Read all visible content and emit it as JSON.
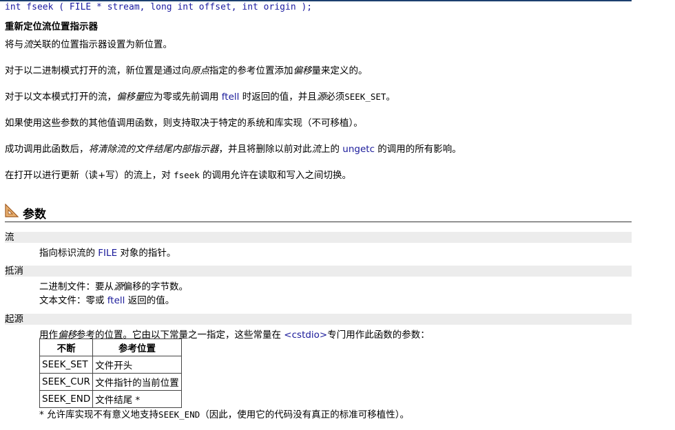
{
  "prototype": "int fseek ( FILE * stream, long int offset, int origin );",
  "heading": "重新定位流位置指示器",
  "p1": {
    "a": "将与",
    "b": "流",
    "c": "关联的位置指示器设置为新位置。"
  },
  "p2": {
    "a": "对于以二进制模式打开的流，新位置是通过向",
    "b": "原点",
    "c": "指定的参考位置添加",
    "d": "偏移",
    "e": "量来定义的。"
  },
  "p3": {
    "a": "对于以文本模式打开的流，",
    "b": "偏移量",
    "c": "应为零或先前调用 ",
    "d": "ftell",
    "e": " 时返回的值，并且",
    "f": "源",
    "g": "必须",
    "h": "SEEK_SET",
    "i": "。"
  },
  "p4": "如果使用这些参数的其他值调用函数，则支持取决于特定的系统和库实现（不可移植）。",
  "p5": {
    "a": "成功调用此函数后，",
    "b": "将清除流的文件结尾内部指示器",
    "c": "，并且将删除以前对此",
    "d": "流",
    "e": "上的 ",
    "f": "ungetc",
    "g": " 的调用的所有影响。"
  },
  "p6": {
    "a": "在打开以进行更新（读+写）的流上，对 ",
    "b": "fseek",
    "c": " 的调用允许在读取和写入之间切换。"
  },
  "section_title": "参数",
  "params": [
    {
      "term": "流",
      "lines": [
        {
          "a": "指向标识流的 ",
          "b": "FILE",
          "c": " 对象的指针。"
        }
      ]
    },
    {
      "term": "抵消",
      "lines": [
        {
          "a": "二进制文件：要从",
          "b": "源",
          "c": "偏移的字节数。"
        },
        {
          "a": "文本文件：零或 ",
          "b": "ftell",
          "c": " 返回的值。"
        }
      ]
    },
    {
      "term": "起源",
      "desc": {
        "a": "用作",
        "b": "偏移",
        "c": "参考的位置。它由以下常量之一指定，这些常量在 ",
        "d": "<cstdio>",
        "e": "专门用作此函数的参数："
      }
    }
  ],
  "table": {
    "headers": [
      "不断",
      "参考位置"
    ],
    "rows": [
      [
        "SEEK_SET",
        "文件开头"
      ],
      [
        "SEEK_CUR",
        "文件指针的当前位置"
      ],
      [
        "SEEK_END",
        "文件结尾 *"
      ]
    ]
  },
  "footnote": {
    "a": "* 允许库实现不有意义地支持",
    "b": "SEEK_END",
    "c": "（因此，使用它的代码没有真正的标准可移植性）。"
  },
  "icons": {
    "section": "ruler-triangle-icon"
  }
}
